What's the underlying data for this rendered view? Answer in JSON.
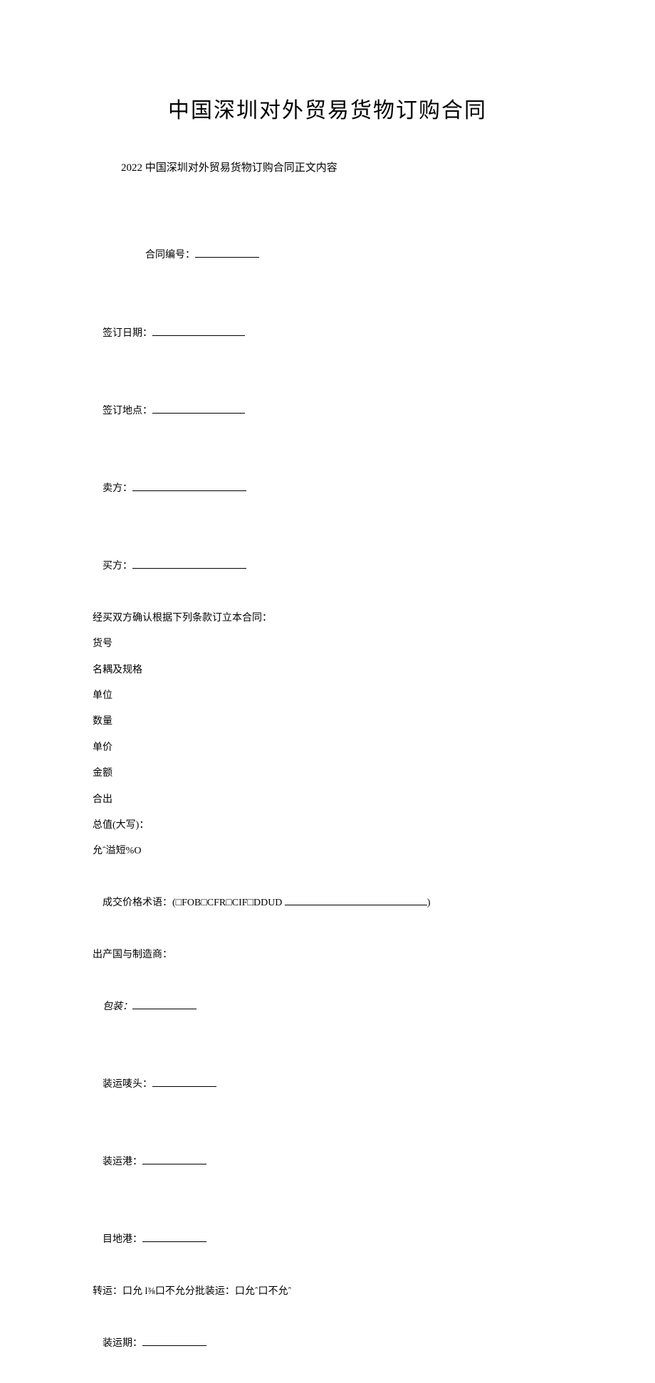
{
  "title": "中国深圳对外贸易货物订购合同",
  "subtitle": "2022 中国深圳对外贸易货物订购合同正文内容",
  "fields": {
    "contract_no_label": "合同编号：",
    "sign_date_label": "签订日期：",
    "sign_place_label": "签订地点：",
    "seller_label": "卖方：",
    "buyer_label": "买方：",
    "confirm_text": "经买双方确认根据下列条款订立本合同：",
    "item_no": "货号",
    "name_spec": "名耦及规格",
    "unit": "单位",
    "quantity": "数量",
    "unit_price": "单价",
    "amount": "金额",
    "total_out": "合出",
    "total_value": "总值(大写)：",
    "tolerance": "允ˆ溢短%O",
    "price_terms": "成交价格术语：(□FOB□CFR□CIF□DDUD ",
    "price_terms_end": ")",
    "origin": "出产国与制造商：",
    "packaging": "包装：",
    "shipping_mark": "装运唛头：",
    "loading_port": "装运港：",
    "dest_port": "目地港：",
    "transshipment": "转运：口允 l⅜口不允分批装运：口允ˆ口不允ˆ",
    "shipment_period": "装运期："
  }
}
